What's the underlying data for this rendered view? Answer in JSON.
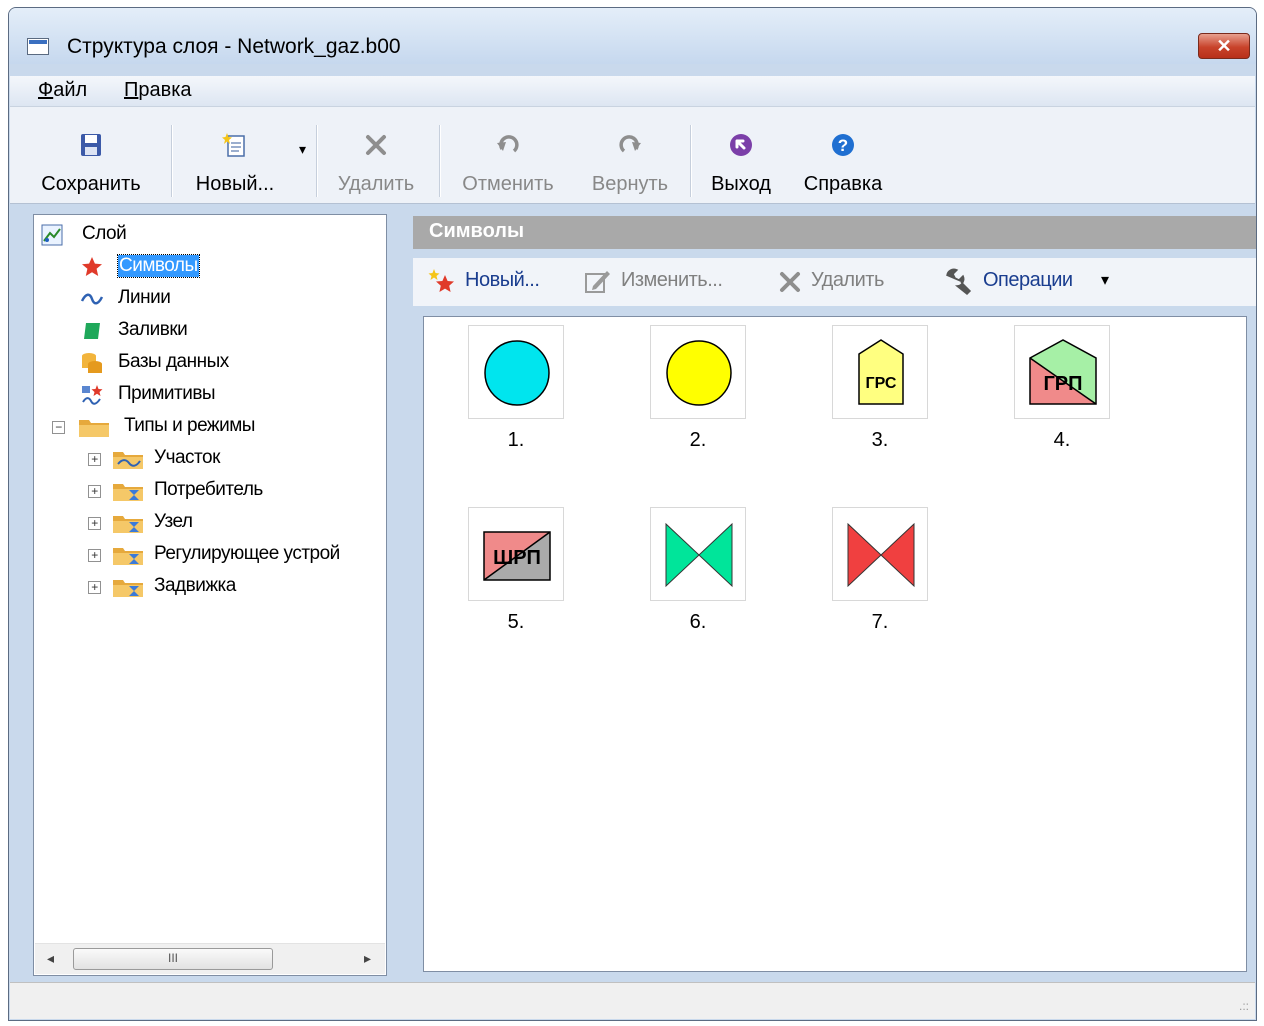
{
  "window": {
    "title": "Структура слоя - Network_gaz.b00",
    "close_glyph": "✕"
  },
  "menu": {
    "items": [
      "Файл",
      "Правка"
    ]
  },
  "toolbar": {
    "save": "Сохранить",
    "new": "Новый...",
    "delete": "Удалить",
    "undo": "Отменить",
    "redo": "Вернуть",
    "exit": "Выход",
    "help": "Справка",
    "dropdown_glyph": "▾"
  },
  "tree": {
    "root": "Слой",
    "items": [
      "Символы",
      "Линии",
      "Заливки",
      "Базы данных",
      "Примитивы"
    ],
    "types_group": "Типы и режимы",
    "types": [
      "Участок",
      "Потребитель",
      "Узел",
      "Регулирующее устрой",
      "Задвижка"
    ],
    "collapse_glyph": "−",
    "expand_glyph": "+",
    "scroll_left": "◂",
    "scroll_right": "▸",
    "scroll_thumb": "III"
  },
  "content": {
    "header": "Символы",
    "toolbar": {
      "new": "Новый...",
      "edit": "Изменить...",
      "delete": "Удалить",
      "operations": "Операции",
      "dropdown_glyph": "▾"
    },
    "symbols": [
      {
        "caption": "1.",
        "kind": "circle",
        "fill": "#00e5ee"
      },
      {
        "caption": "2.",
        "kind": "circle",
        "fill": "#ffff00"
      },
      {
        "caption": "3.",
        "kind": "pentagon",
        "fill": "#ffff80",
        "text": "ГРС"
      },
      {
        "caption": "4.",
        "kind": "pentagon-split",
        "fill_top": "#a6f0a6",
        "fill_bottom": "#f08a8a",
        "text": "ГРП"
      },
      {
        "caption": "5.",
        "kind": "rect-split",
        "fill_top": "#f08a8a",
        "fill_bottom": "#aaaaaa",
        "text": "ШРП"
      },
      {
        "caption": "6.",
        "kind": "bowtie",
        "fill": "#00e59a"
      },
      {
        "caption": "7.",
        "kind": "bowtie",
        "fill": "#f04040"
      }
    ]
  },
  "status": {
    "grip": ".::"
  }
}
